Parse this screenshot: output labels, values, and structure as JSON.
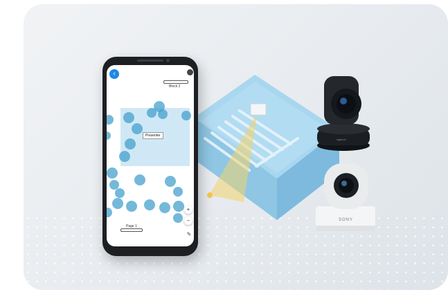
{
  "phone_app": {
    "back_icon": "chevron-left-icon",
    "top_label": "Block 2",
    "bottom_label": "Page 1",
    "presenter_label": "Presenter",
    "zoom_in_glyph": "+",
    "zoom_out_glyph": "−",
    "edit_icon": "pencil-icon"
  },
  "devices": {
    "ptz_camera_brand": "logitech",
    "white_camera_brand": "SONY"
  },
  "colors": {
    "accent_blue": "#1e88e5",
    "room_blue": "#8ccbe8",
    "seat_dot": "#46a0cd",
    "cone_yellow": "#f2d46b"
  }
}
